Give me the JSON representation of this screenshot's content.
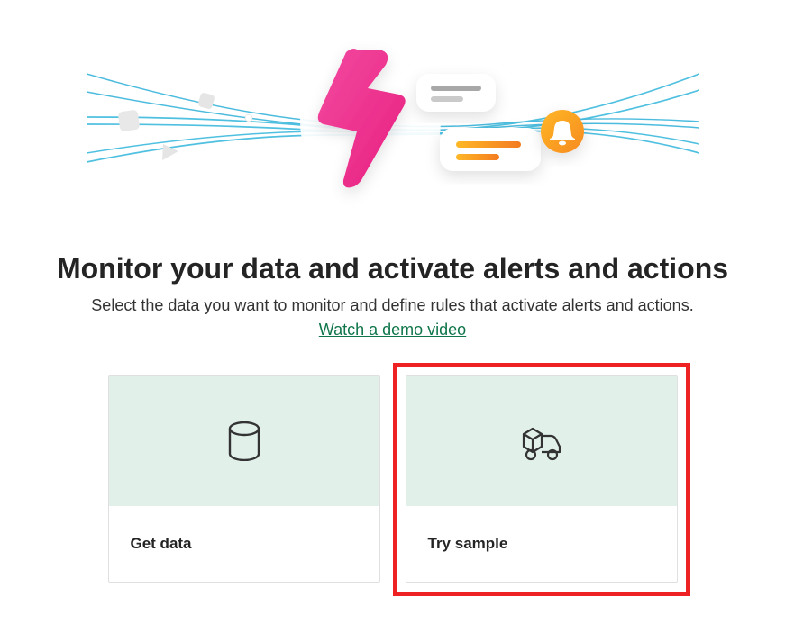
{
  "heading": "Monitor your data and activate alerts and actions",
  "subheading": "Select the data you want to monitor and define rules that activate alerts and actions.",
  "demo_link": "Watch a demo video",
  "cards": {
    "get_data": {
      "label": "Get data"
    },
    "try_sample": {
      "label": "Try sample"
    }
  }
}
